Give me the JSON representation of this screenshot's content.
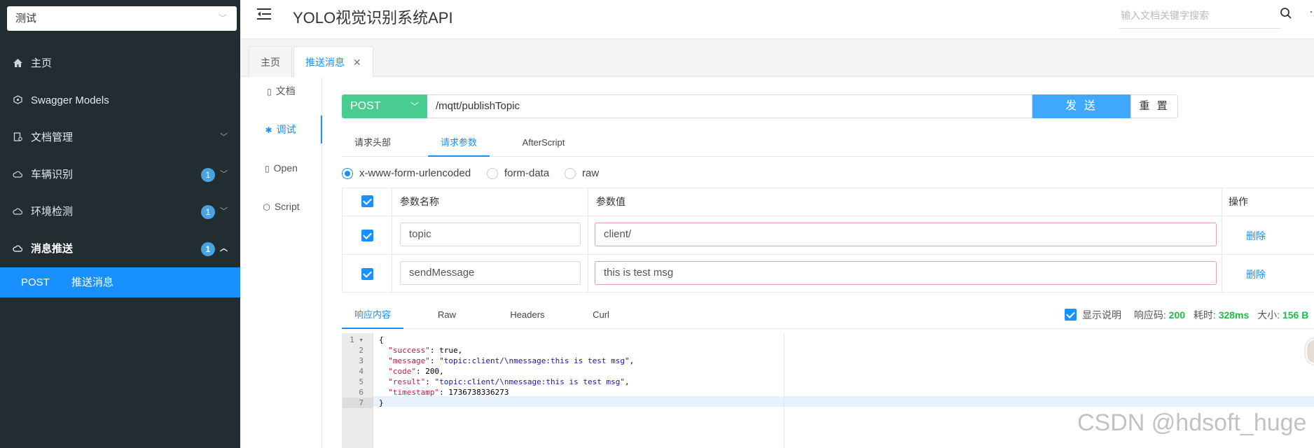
{
  "sidebar": {
    "group_select": "测试",
    "items": [
      {
        "label": "主页",
        "icon": "home-icon"
      },
      {
        "label": "Swagger Models",
        "icon": "cube-icon"
      },
      {
        "label": "文档管理",
        "icon": "doc-manage-icon"
      },
      {
        "label": "车辆识别",
        "icon": "cloud-icon",
        "badge": "1"
      },
      {
        "label": "环境检测",
        "icon": "cloud-icon",
        "badge": "1"
      },
      {
        "label": "消息推送",
        "icon": "cloud-icon",
        "badge": "1"
      }
    ],
    "sub_item": {
      "method": "POST",
      "name": "推送消息"
    }
  },
  "header": {
    "title": "YOLO视觉识别系统API",
    "search_placeholder": "输入文档关键字搜索"
  },
  "tabs": [
    {
      "label": "主页"
    },
    {
      "label": "推送消息",
      "close": "✕"
    }
  ],
  "docnav": [
    {
      "label": "文档",
      "icon": "file-icon"
    },
    {
      "label": "调试",
      "icon": "bug-icon"
    },
    {
      "label": "Open",
      "icon": "file-icon"
    },
    {
      "label": "Script",
      "icon": "script-icon"
    }
  ],
  "request": {
    "method": "POST",
    "url": "/mqtt/publishTopic",
    "send_label": "发 送",
    "reset_label": "重 置"
  },
  "request_tabs": [
    "请求头部",
    "请求参数",
    "AfterScript"
  ],
  "content_types": [
    "x-www-form-urlencoded",
    "form-data",
    "raw"
  ],
  "params_table": {
    "headers": [
      "参数名称",
      "参数值",
      "操作"
    ],
    "rows": [
      {
        "name": "topic",
        "value": "client/",
        "action": "删除"
      },
      {
        "name": "sendMessage",
        "value": "this is test msg",
        "action": "删除"
      }
    ]
  },
  "response_tabs": [
    "响应内容",
    "Raw",
    "Headers",
    "Curl"
  ],
  "response_meta": {
    "show_desc": "显示说明",
    "code_label": "响应码:",
    "code": "200",
    "time_label": "耗时:",
    "time": "328ms",
    "size_label": "大小:",
    "size": "156 B"
  },
  "code_lines": [
    "{",
    "  \"success\": true,",
    "  \"message\": \"topic:client/\\nmessage:this is test msg\",",
    "  \"code\": 200,",
    "  \"result\": \"topic:client/\\nmessage:this is test msg\",",
    "  \"timestamp\": 1736738336273",
    "}"
  ],
  "code_parts": [
    [
      {
        "t": "{",
        "c": "n"
      }
    ],
    [
      {
        "t": "  ",
        "c": "n"
      },
      {
        "t": "\"success\"",
        "c": "k"
      },
      {
        "t": ": true,",
        "c": "n"
      }
    ],
    [
      {
        "t": "  ",
        "c": "n"
      },
      {
        "t": "\"message\"",
        "c": "k"
      },
      {
        "t": ": ",
        "c": "n"
      },
      {
        "t": "\"topic:client/\\nmessage:this is test msg\"",
        "c": "s"
      },
      {
        "t": ",",
        "c": "n"
      }
    ],
    [
      {
        "t": "  ",
        "c": "n"
      },
      {
        "t": "\"code\"",
        "c": "k"
      },
      {
        "t": ": 200,",
        "c": "n"
      }
    ],
    [
      {
        "t": "  ",
        "c": "n"
      },
      {
        "t": "\"result\"",
        "c": "k"
      },
      {
        "t": ": ",
        "c": "n"
      },
      {
        "t": "\"topic:client/\\nmessage:this is test msg\"",
        "c": "s"
      },
      {
        "t": ",",
        "c": "n"
      }
    ],
    [
      {
        "t": "  ",
        "c": "n"
      },
      {
        "t": "\"timestamp\"",
        "c": "k"
      },
      {
        "t": ": 1736738336273",
        "c": "n"
      }
    ],
    [
      {
        "t": "}",
        "c": "n"
      }
    ]
  ],
  "watermark": "CSDN @hdsoft_huge",
  "colors": {
    "sidebar_bg": "#222d32",
    "accent": "#1890ff",
    "post_green": "#49cc90",
    "send_blue": "#40a9ff",
    "ok_green": "#21ba45"
  }
}
